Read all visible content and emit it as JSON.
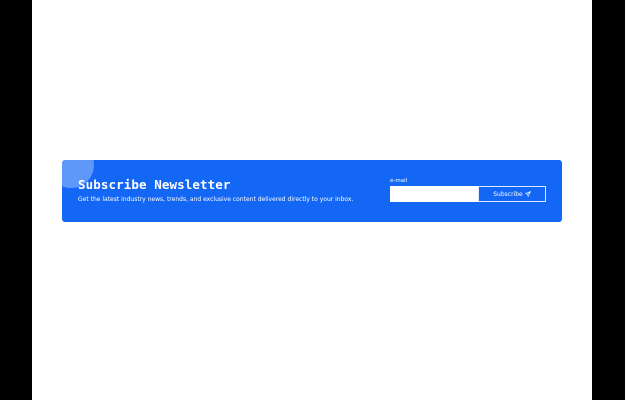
{
  "newsletter": {
    "title": "Subscribe Newsletter",
    "description": "Get the latest industry news, trends, and exclusive content delivered directly to your inbox.",
    "email_label": "e-mail",
    "email_value": "",
    "subscribe_label": "Subscribe",
    "subscribe_icon": "send-icon"
  },
  "colors": {
    "banner_background": "#1467f5",
    "page_background": "#ffffff",
    "outer_background": "#000000",
    "text": "#ffffff"
  }
}
